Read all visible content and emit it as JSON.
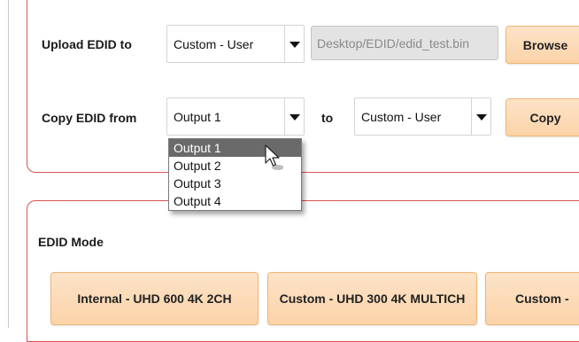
{
  "upload_edid": {
    "label": "Upload EDID to",
    "target_value": "Custom - User",
    "file_path": "Desktop/EDID/edid_test.bin",
    "browse_label": "Browse"
  },
  "copy_edid": {
    "label": "Copy EDID from",
    "source_value": "Output 1",
    "to_label": "to",
    "target_value": "Custom - User",
    "copy_label": "Copy",
    "options": [
      "Output 1",
      "Output 2",
      "Output 3",
      "Output 4"
    ],
    "highlighted_option": "Output 1"
  },
  "edid_mode": {
    "label": "EDID Mode",
    "buttons": [
      "Internal - UHD 600 4K 2CH",
      "Custom - UHD 300 4K MULTICH",
      "Custom -"
    ]
  }
}
